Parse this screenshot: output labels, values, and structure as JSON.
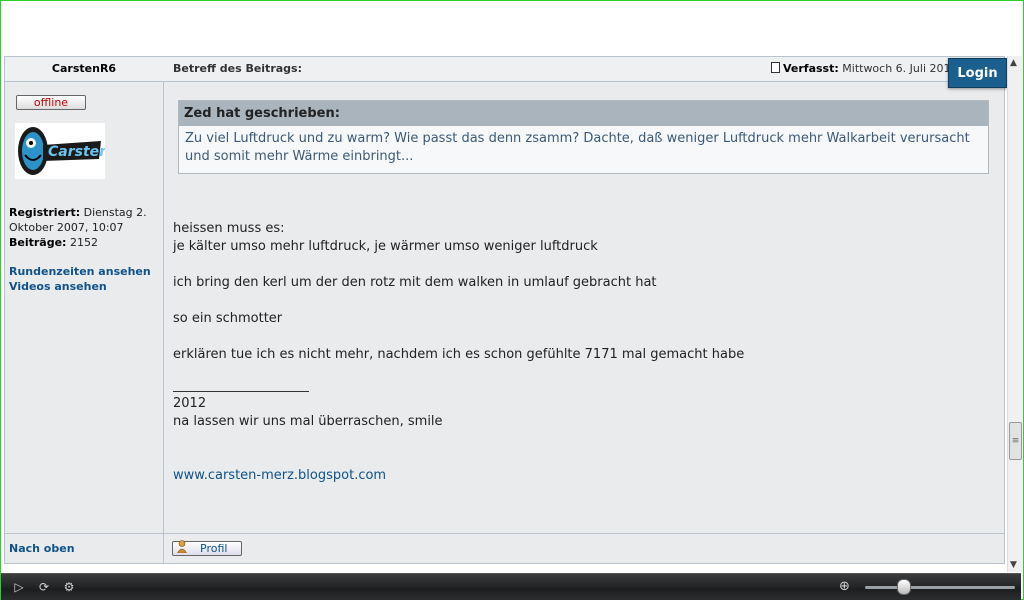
{
  "header": {
    "author": "CarstenR6",
    "subject_label": "Betreff des Beitrags:",
    "posted_label": "Verfasst:",
    "posted_value": "Mittwoch 6. Juli 2011"
  },
  "login_label": "Login",
  "user": {
    "status": "offline",
    "avatar_text": "Carsten",
    "registered_label": "Registriert:",
    "registered_value": "Dienstag 2. Oktober 2007, 10:07",
    "posts_label": "Beiträge:",
    "posts_value": "2152",
    "links": [
      "Rundenzeiten ansehen",
      "Videos ansehen"
    ]
  },
  "quote": {
    "header": "Zed hat geschrieben:",
    "text": "Zu viel Luftdruck und zu warm? Wie passt das denn zsamm? Dachte, daß weniger Luftdruck mehr Walkarbeit verursacht und somit mehr Wärme einbringt..."
  },
  "post": {
    "line1": "heissen muss es:",
    "line2": "je kälter umso mehr luftdruck, je wärmer umso weniger luftdruck",
    "line3": "ich bring den kerl um der den rotz mit dem walken in umlauf gebracht hat",
    "line4": "so ein schmotter",
    "line5": "erklären tue ich es nicht mehr, nachdem ich es schon gefühlte 7171 mal gemacht habe"
  },
  "signature": {
    "line1": "2012",
    "line2": "na lassen wir uns mal überraschen, smile",
    "url": "www.carsten-merz.blogspot.com"
  },
  "footer": {
    "top_link": "Nach oben",
    "profile_button": "Profil"
  },
  "icons": {
    "document": "document-icon",
    "play": "play-icon",
    "refresh": "refresh-icon",
    "settings": "settings-icon",
    "zoom": "zoom-icon"
  },
  "player": {
    "zoom_level": 0.25
  }
}
